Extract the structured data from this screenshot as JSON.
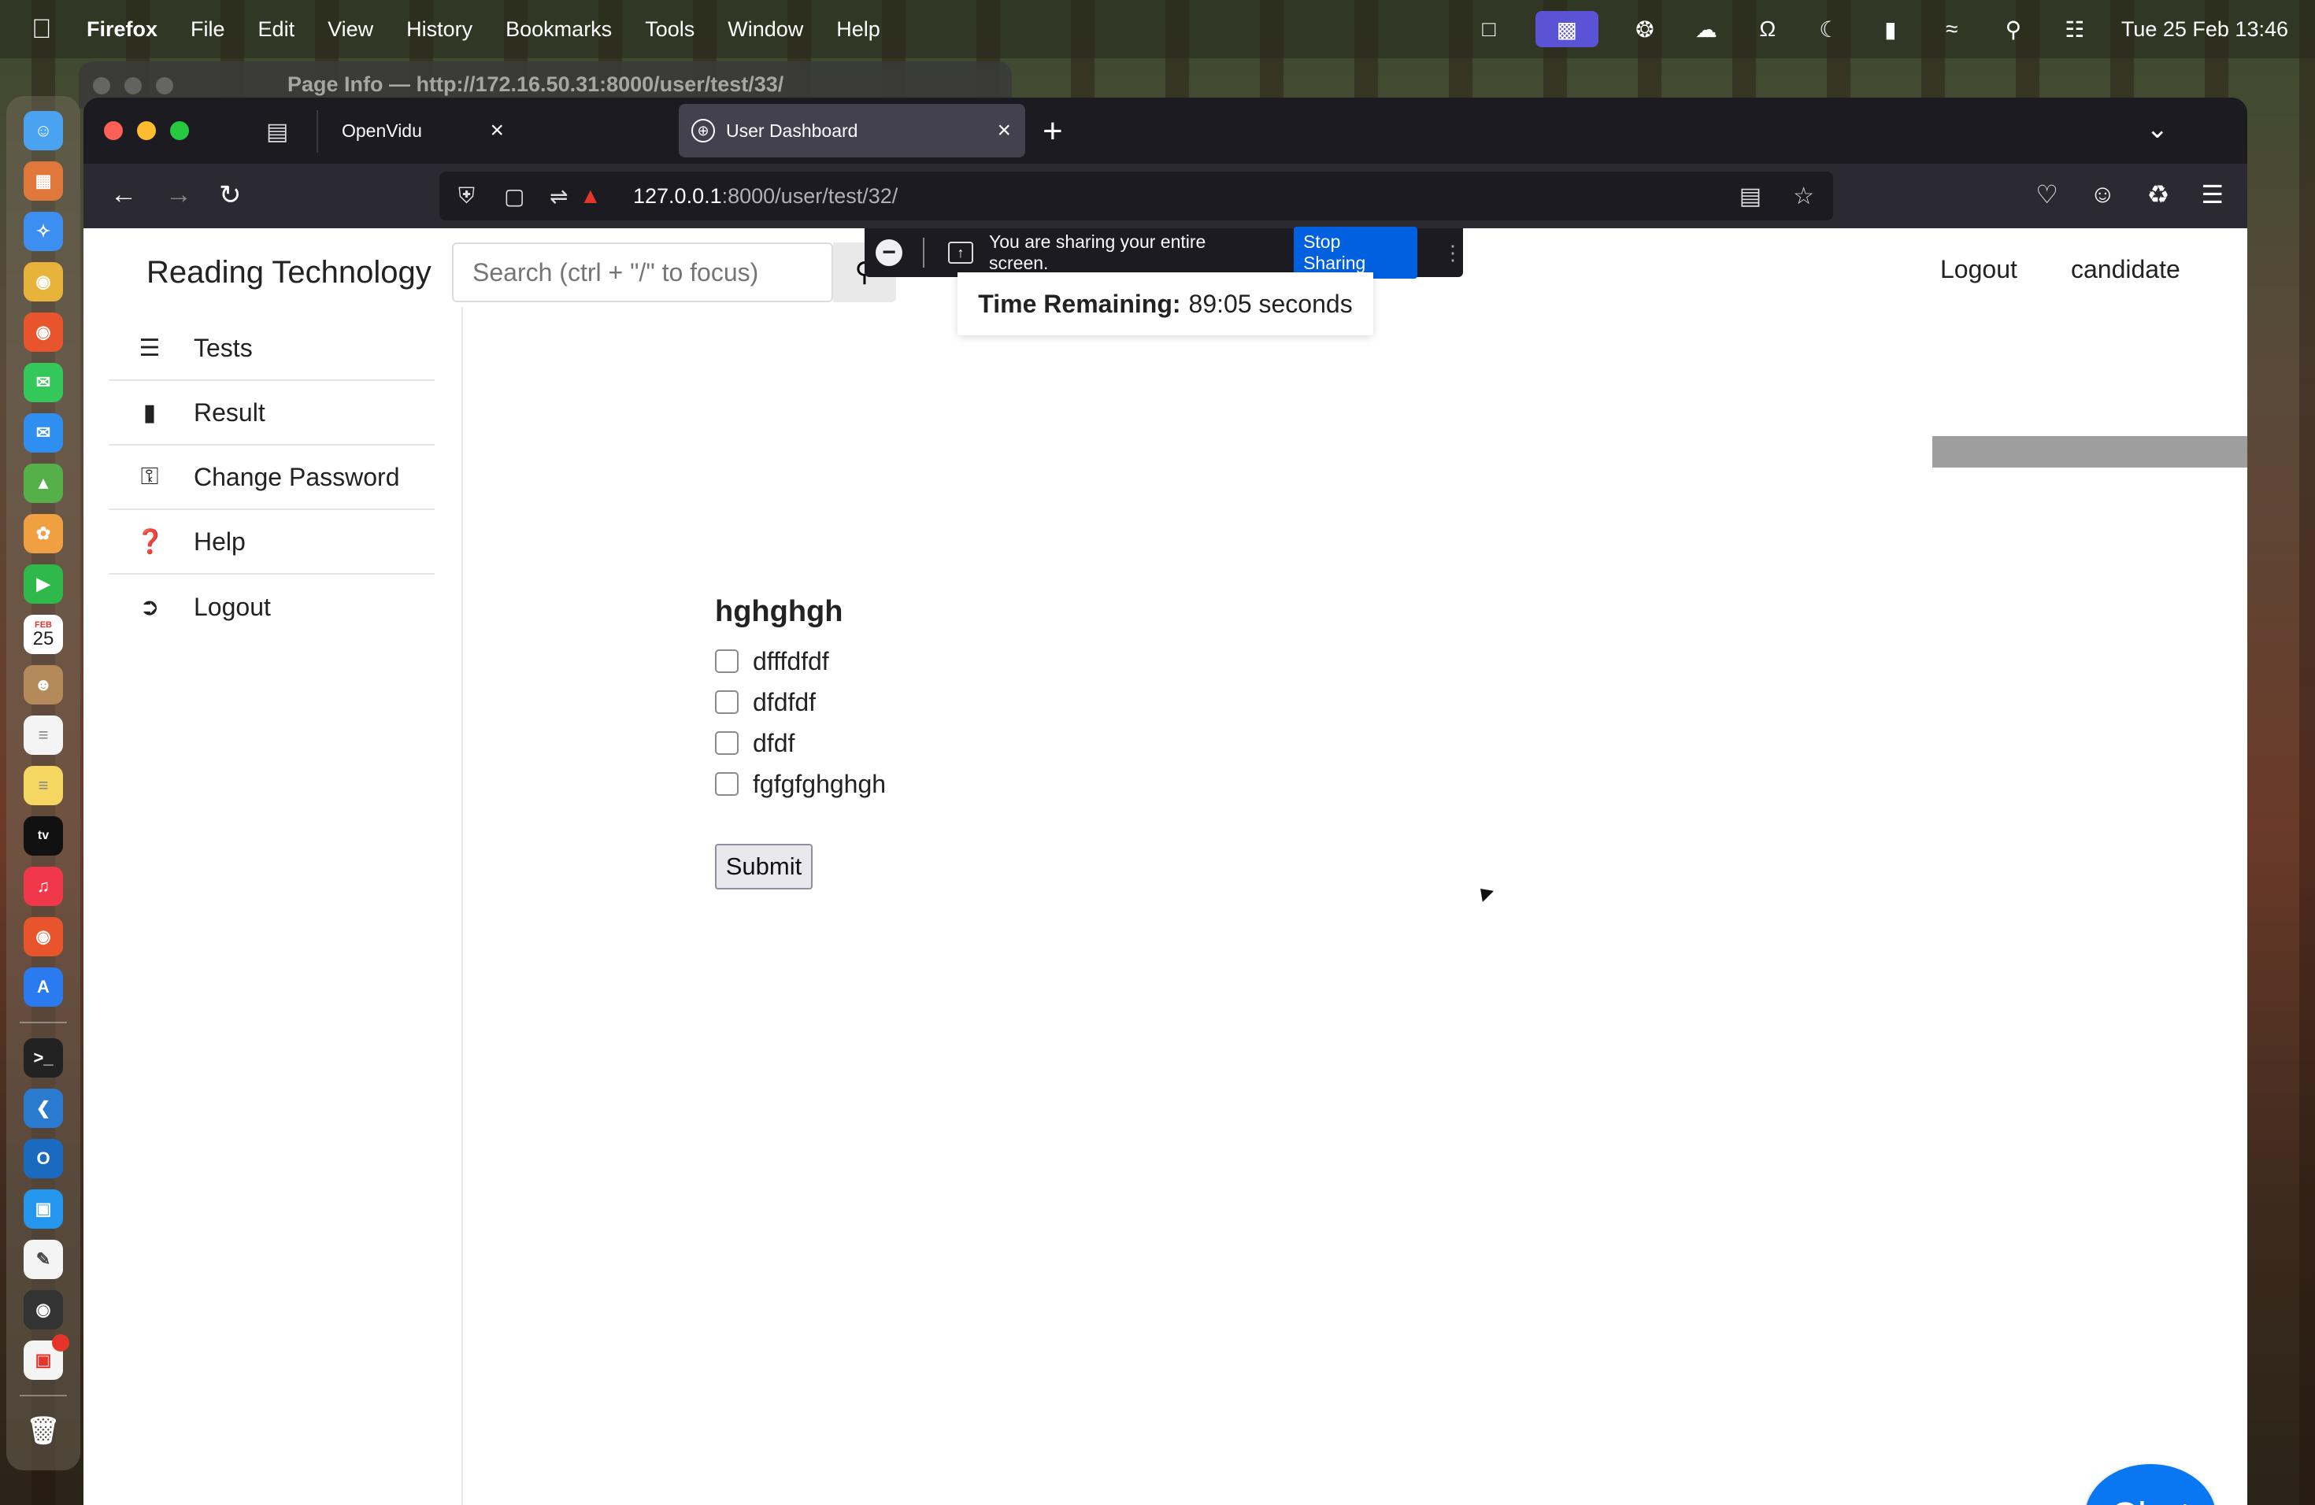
{
  "menubar": {
    "app": "Firefox",
    "items": [
      "File",
      "Edit",
      "View",
      "History",
      "Bookmarks",
      "Tools",
      "Window",
      "Help"
    ],
    "datetime": "Tue 25 Feb  13:46"
  },
  "background_window": {
    "title": "Page Info — http://172.16.50.31:8000/user/test/33/"
  },
  "dock": {
    "calendar_month": "FEB",
    "calendar_day": "25",
    "badge_count": "2"
  },
  "browser": {
    "tabs": [
      {
        "label": "OpenVidu"
      },
      {
        "label": "User Dashboard"
      }
    ],
    "url_host": "127.0.0.1",
    "url_rest": ":8000/user/test/32/"
  },
  "sharing_bar": {
    "message": "You are sharing your entire screen.",
    "stop_label": "Stop Sharing"
  },
  "header": {
    "brand": "Reading Technology",
    "search_placeholder": "Search (ctrl + \"/\" to focus)",
    "logout_label": "Logout",
    "user_label": "candidate"
  },
  "sidebar": {
    "items": [
      {
        "label": "Tests",
        "icon": "list-check-icon"
      },
      {
        "label": "Result",
        "icon": "clipboard-icon"
      },
      {
        "label": "Change Password",
        "icon": "key-icon"
      },
      {
        "label": "Help",
        "icon": "question-circle-icon"
      },
      {
        "label": "Logout",
        "icon": "sign-out-icon"
      }
    ]
  },
  "timer": {
    "label": "Time Remaining:",
    "value": "89:05 seconds"
  },
  "quiz": {
    "question": "hghghgh",
    "options": [
      "dfffdfdf",
      "dfdfdf",
      "dfdf",
      "fgfgfghghgh"
    ],
    "submit_label": "Submit"
  },
  "chat": {
    "label": "Chat"
  },
  "colors": {
    "accent_blue": "#0060df",
    "chat_blue": "#0a77f2",
    "firefox_toolbar": "#2b2a33"
  }
}
